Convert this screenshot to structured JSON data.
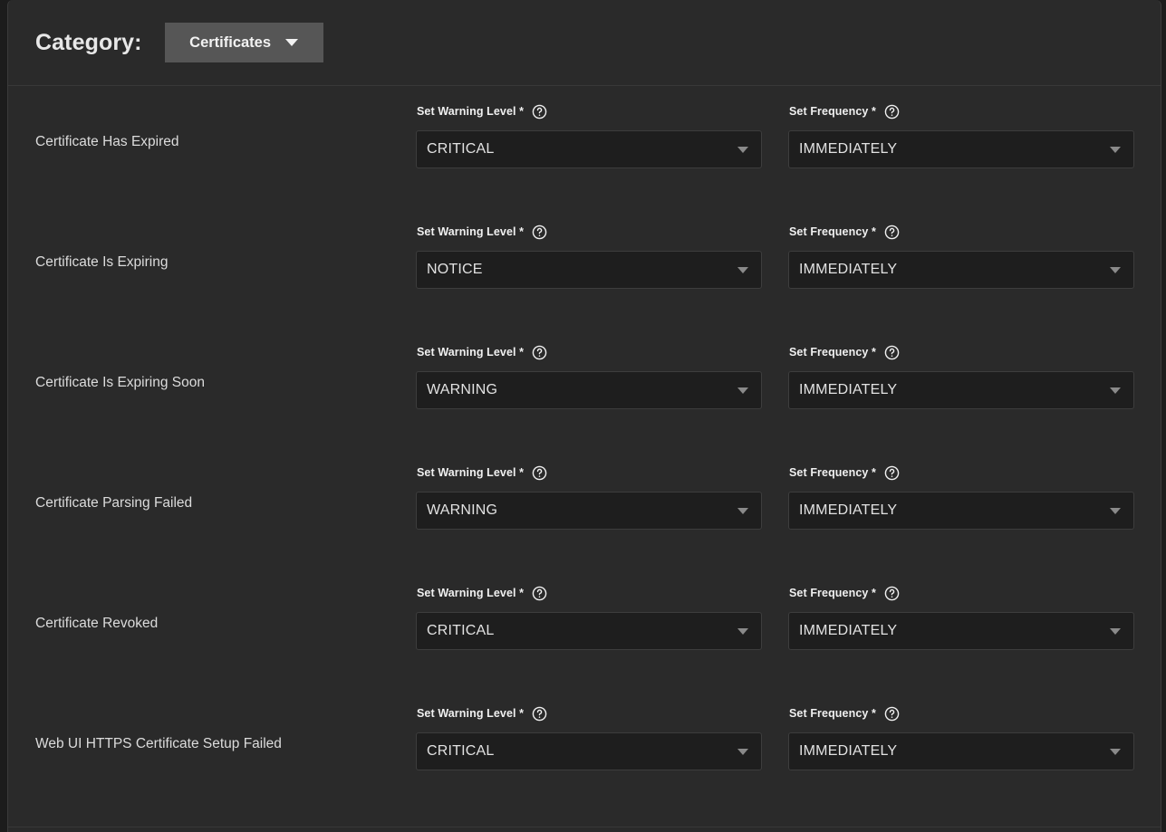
{
  "header": {
    "category_label": "Category:",
    "category_value": "Certificates",
    "caret_icon": "chevron-down-icon"
  },
  "field_labels": {
    "warning_level": "Set Warning Level *",
    "frequency": "Set Frequency *",
    "help_icon": "help-circle-icon",
    "select_caret_icon": "chevron-down-icon"
  },
  "rows": [
    {
      "name": "Certificate Has Expired",
      "warning_level": "CRITICAL",
      "frequency": "IMMEDIATELY"
    },
    {
      "name": "Certificate Is Expiring",
      "warning_level": "NOTICE",
      "frequency": "IMMEDIATELY"
    },
    {
      "name": "Certificate Is Expiring Soon",
      "warning_level": "WARNING",
      "frequency": "IMMEDIATELY"
    },
    {
      "name": "Certificate Parsing Failed",
      "warning_level": "WARNING",
      "frequency": "IMMEDIATELY"
    },
    {
      "name": "Certificate Revoked",
      "warning_level": "CRITICAL",
      "frequency": "IMMEDIATELY"
    },
    {
      "name": "Web UI HTTPS Certificate Setup Failed",
      "warning_level": "CRITICAL",
      "frequency": "IMMEDIATELY"
    }
  ],
  "colors": {
    "page_background": "#1c1c1c",
    "panel_background": "#2a2a2a",
    "select_background": "#1e1e1e",
    "dropdown_button": "#565656",
    "text_primary": "#e8e8e8",
    "border": "#3d3d3d"
  }
}
